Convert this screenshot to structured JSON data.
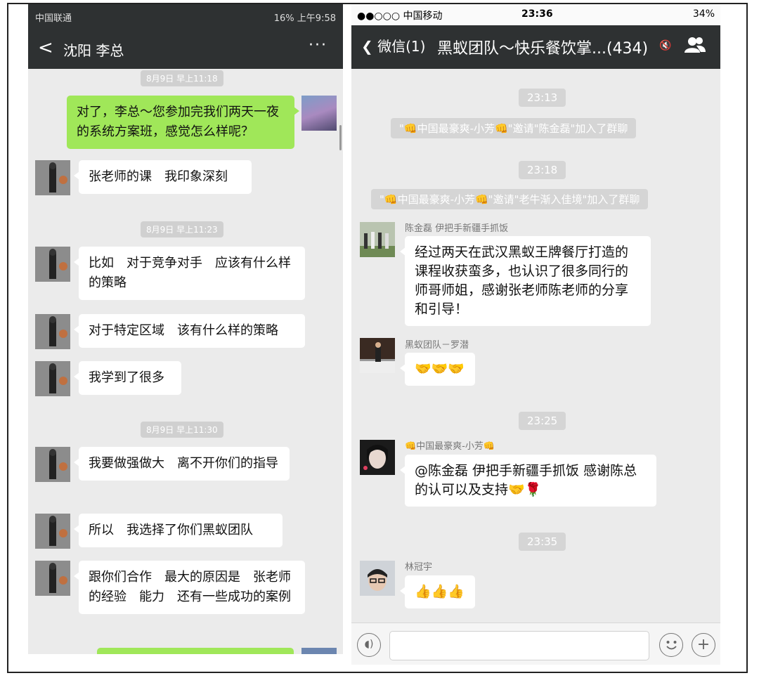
{
  "left": {
    "status": {
      "carrier": "中国联通",
      "right": "16% 上午9:58"
    },
    "nav": {
      "back": "<",
      "title": "沈阳 李总",
      "more": "···"
    },
    "timestamps": [
      "8月9日 早上11:18",
      "8月9日 早上11:23",
      "8月9日 早上11:30"
    ],
    "messages": [
      "对了，李总～您参加完我们两天一夜的系统方案班，感觉怎么样呢？",
      "张老师的课　我印象深刻",
      "比如　对于竞争对手　应该有什么样的策略",
      "对于特定区域　该有什么样的策略",
      "我学到了很多",
      "我要做强做大　离不开你们的指导",
      "所以　我选择了你们黑蚁团队",
      "跟你们合作　最大的原因是　张老师的经验　能力　还有一些成功的案例"
    ]
  },
  "right": {
    "status": {
      "carrier": "●●○○○ 中国移动",
      "time": "23:36",
      "battery": "34%"
    },
    "nav": {
      "back": "微信(1)",
      "title": "黑蚁团队～快乐餐饮掌...(434)"
    },
    "times": [
      "23:13",
      "23:18",
      "23:25",
      "23:35"
    ],
    "system": [
      "\"👊中国最豪爽-小芳👊\"邀请\"陈金磊\"加入了群聊",
      "\"👊中国最豪爽-小芳👊\"邀请\"老牛渐入佳境\"加入了群聊"
    ],
    "messages": [
      {
        "sender": "陈金磊 伊把手新疆手抓饭",
        "text": "经过两天在武汉黑蚁王牌餐厅打造的课程收获蛮多，也认识了很多同行的师哥师姐，感谢张老师陈老师的分享和引导！"
      },
      {
        "sender": "黑蚁团队－罗潜",
        "text": "🤝🤝🤝"
      },
      {
        "sender": "👊中国最豪爽-小芳👊",
        "text": "@陈金磊 伊把手新疆手抓饭 感谢陈总的认可以及支持🤝🌹"
      },
      {
        "sender": "林冠宇",
        "text": "👍👍👍"
      }
    ]
  }
}
